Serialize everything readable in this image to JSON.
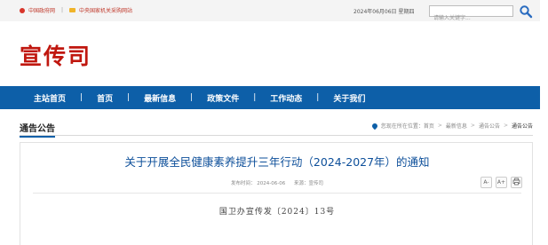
{
  "topbar": {
    "gov_link": "中国政府网",
    "divider": "|",
    "org_link": "中央国家机关采购网站",
    "date": "2024年06月06日 星期四",
    "search_placeholder": "请输入关键字..."
  },
  "logo": "宣传司",
  "nav": {
    "items": [
      "主站首页",
      "首页",
      "最新信息",
      "政策文件",
      "工作动态",
      "关于我们"
    ],
    "divider": "|"
  },
  "section": {
    "title": "通告公告",
    "breadcrumb": {
      "prefix": "您现在所在位置：",
      "items": [
        "首页",
        "最新信息",
        "通告公告"
      ],
      "current": "通告公告"
    }
  },
  "article": {
    "title": "关于开展全民健康素养提升三年行动（2024-2027年）的通知",
    "published": "发布时间：  2024-06-06",
    "source": "来源：宣传司",
    "tools": [
      "A-",
      "A+",
      "print"
    ],
    "doc_number": "国卫办宣传发〔2024〕13号"
  }
}
